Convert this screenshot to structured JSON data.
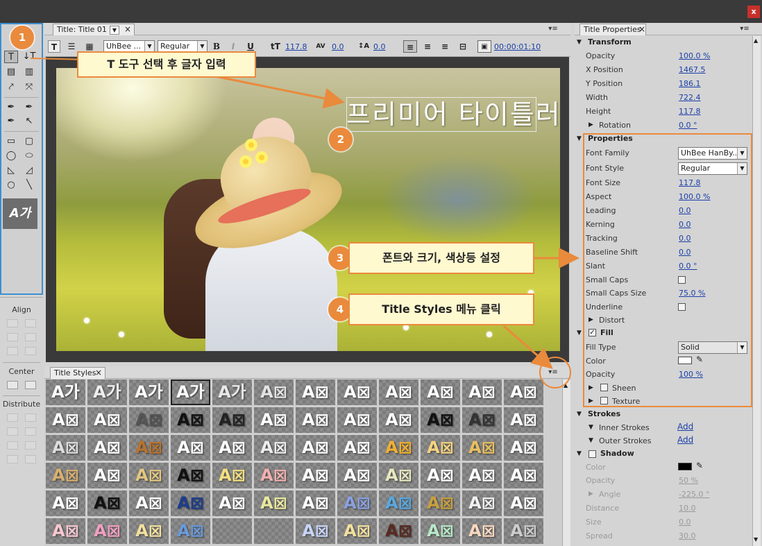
{
  "window": {
    "close_label": "x"
  },
  "title_panel": {
    "tab": "Title: Title 01",
    "dropdown_arrow": "▼",
    "close": "×",
    "menu": "▾≡"
  },
  "toolbar": {
    "font_family": "UhBee ...",
    "font_style": "Regular",
    "bold": "B",
    "italic": "I",
    "underline": "U",
    "font_size": "117.8",
    "kerning": "0.0",
    "leading": "0.0",
    "timecode": "00:00:01:10"
  },
  "video": {
    "title_text": "프리미어 타이틀러"
  },
  "annotations": [
    {
      "num": "1",
      "text": ""
    },
    {
      "num": "",
      "text": "T 도구 선택 후 글자 입력"
    },
    {
      "num": "2",
      "text": ""
    },
    {
      "num": "3",
      "text": "폰트와 크기, 색상등 설정"
    },
    {
      "num": "4",
      "text": "Title Styles 메뉴 클릭"
    }
  ],
  "sidebar": {
    "align": "Align",
    "center": "Center",
    "distribute": "Distribute",
    "style_preview": "A가"
  },
  "styles_panel": {
    "tab": "Title Styles",
    "close": "×",
    "menu": "▾≡",
    "rows": [
      [
        "A가",
        "A가",
        "A가",
        "A가",
        "A가",
        "A⊠",
        "A⊠",
        "A⊠",
        "A⊠",
        "A⊠",
        "A⊠",
        "A⊠"
      ],
      [
        "A⊠",
        "A⊠",
        "A⊠",
        "A⊠",
        "A⊠",
        "A⊠",
        "A⊠",
        "A⊠",
        "A⊠",
        "A⊠",
        "A⊠",
        "A⊠"
      ],
      [
        "A⊠",
        "A⊠",
        "A⊠",
        "A⊠",
        "A⊠",
        "A⊠",
        "A⊠",
        "A⊠",
        "A⊠",
        "A⊠",
        "A⊠",
        "A⊠"
      ],
      [
        "A⊠",
        "A⊠",
        "A⊠",
        "A⊠",
        "A⊠",
        "A⊠",
        "A⊠",
        "A⊠",
        "A⊠",
        "A⊠",
        "A⊠",
        "A⊠"
      ],
      [
        "A⊠",
        "A⊠",
        "A⊠",
        "A⊠",
        "A⊠",
        "A⊠",
        "A⊠",
        "A⊠",
        "A⊠",
        "A⊠",
        "A⊠",
        "A⊠"
      ],
      [
        "A⊠",
        "A⊠",
        "A⊠",
        "A⊠",
        "",
        "",
        "A⊠",
        "A⊠",
        "A⊠",
        "A⊠",
        "A⊠",
        "A⊠"
      ]
    ]
  },
  "properties": {
    "tab": "Title Properties",
    "close": "×",
    "menu": "▾≡",
    "transform": {
      "header": "Transform",
      "opacity_label": "Opacity",
      "opacity": "100.0 %",
      "x_label": "X Position",
      "x": "1467.5",
      "y_label": "Y Position",
      "y": "186.1",
      "width_label": "Width",
      "width": "722.4",
      "height_label": "Height",
      "height": "117.8",
      "rotation_label": "Rotation",
      "rotation": "0.0 °"
    },
    "props": {
      "header": "Properties",
      "font_family_label": "Font Family",
      "font_family": "UhBee HanBy...",
      "font_style_label": "Font Style",
      "font_style": "Regular",
      "font_size_label": "Font Size",
      "font_size": "117.8",
      "aspect_label": "Aspect",
      "aspect": "100.0 %",
      "leading_label": "Leading",
      "leading": "0.0",
      "kerning_label": "Kerning",
      "kerning": "0.0",
      "tracking_label": "Tracking",
      "tracking": "0.0",
      "baseline_label": "Baseline Shift",
      "baseline": "0.0",
      "slant_label": "Slant",
      "slant": "0.0 °",
      "small_caps_label": "Small Caps",
      "small_caps_size_label": "Small Caps Size",
      "small_caps_size": "75.0 %",
      "underline_label": "Underline",
      "distort_label": "Distort"
    },
    "fill": {
      "header": "Fill",
      "check": "✓",
      "type_label": "Fill Type",
      "type": "Solid",
      "color_label": "Color",
      "color_hex": "#ffffff",
      "opacity_label": "Opacity",
      "opacity": "100 %",
      "sheen_label": "Sheen",
      "texture_label": "Texture"
    },
    "strokes": {
      "header": "Strokes",
      "inner_label": "Inner Strokes",
      "inner_add": "Add",
      "outer_label": "Outer Strokes",
      "outer_add": "Add"
    },
    "shadow": {
      "header": "Shadow",
      "color_label": "Color",
      "color_hex": "#000000",
      "opacity_label": "Opacity",
      "opacity": "50 %",
      "angle_label": "Angle",
      "angle": "-225.0 °",
      "distance_label": "Distance",
      "distance": "10.0",
      "size_label": "Size",
      "size": "0.0",
      "spread_label": "Spread",
      "spread": "30.0"
    }
  },
  "colors": {
    "accent_orange": "#ea8a3c",
    "callout_fill": "#fff9cf",
    "tools_border": "#3d8fd1",
    "link_blue": "#1a3fa8"
  }
}
